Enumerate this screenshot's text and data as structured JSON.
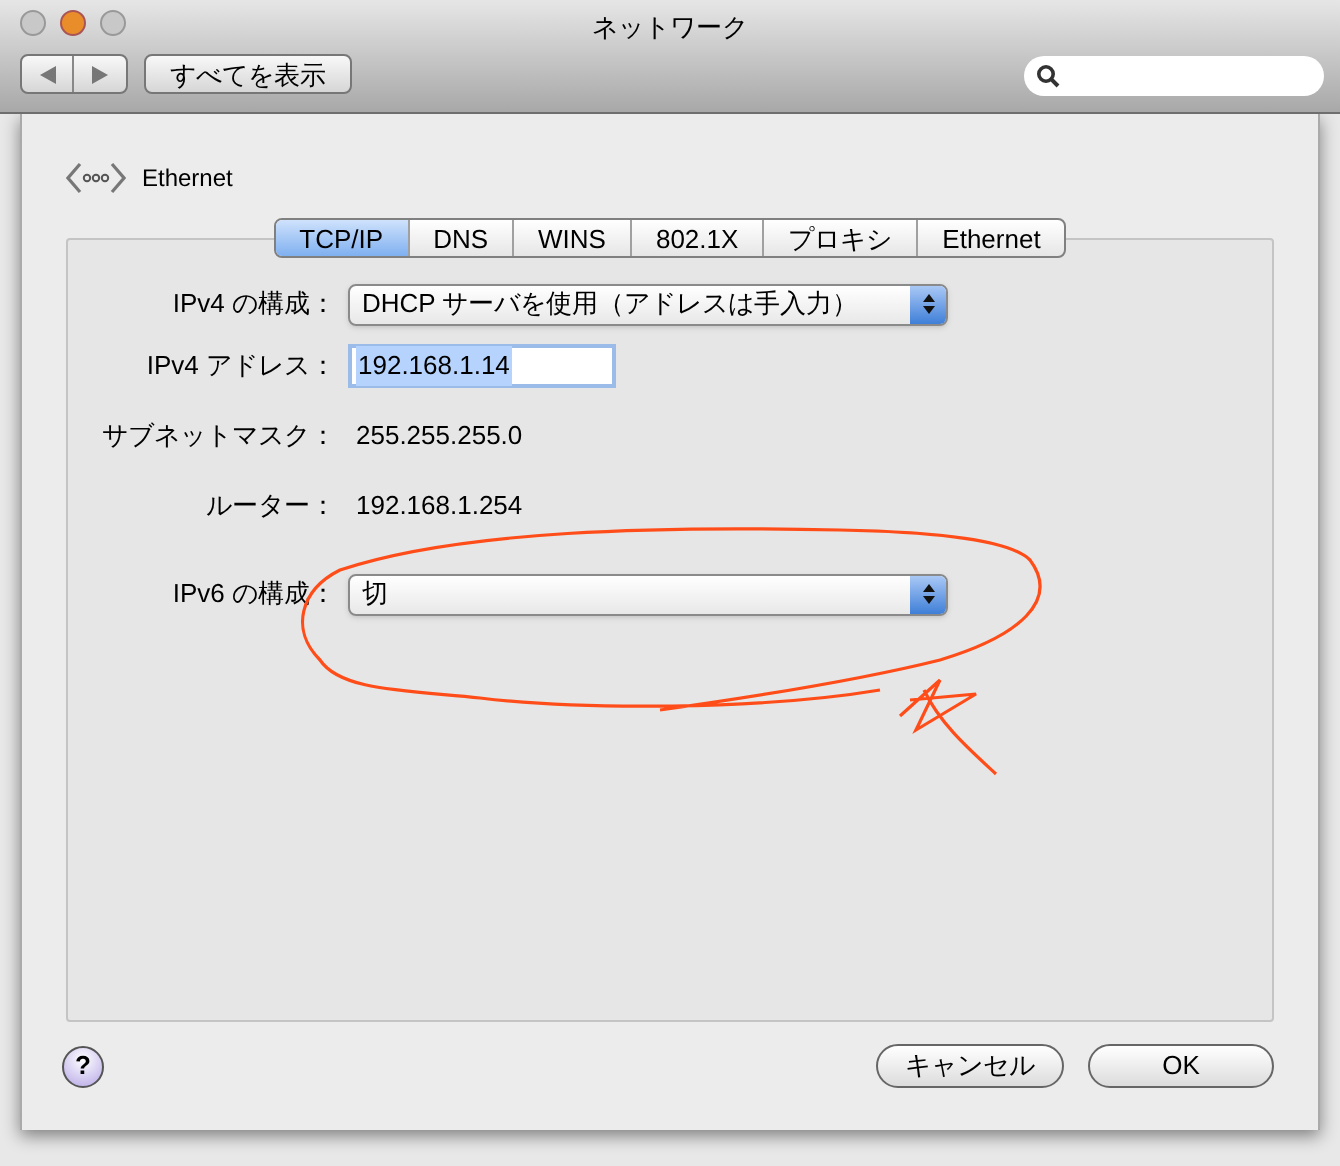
{
  "window": {
    "title": "ネットワーク",
    "show_all_button": "すべてを表示"
  },
  "sheet": {
    "service": "Ethernet",
    "tabs": [
      {
        "label": "TCP/IP",
        "selected": true
      },
      {
        "label": "DNS",
        "selected": false
      },
      {
        "label": "WINS",
        "selected": false
      },
      {
        "label": "802.1X",
        "selected": false
      },
      {
        "label": "プロキシ",
        "selected": false
      },
      {
        "label": "Ethernet",
        "selected": false
      }
    ],
    "rows": [
      {
        "kind": "popup",
        "label": "IPv4 の構成：",
        "value": "DHCP サーバを使用（アドレスは手入力）"
      },
      {
        "kind": "field",
        "label": "IPv4 アドレス：",
        "value": "192.168.1.14"
      },
      {
        "kind": "text",
        "label": "サブネットマスク：",
        "value": "255.255.255.0"
      },
      {
        "kind": "text",
        "label": "ルーター：",
        "value": "192.168.1.254"
      },
      {
        "kind": "popup",
        "label": "IPv6 の構成：",
        "value": "切"
      }
    ],
    "buttons": {
      "help": "?",
      "cancel": "キャンセル",
      "ok": "OK"
    }
  }
}
